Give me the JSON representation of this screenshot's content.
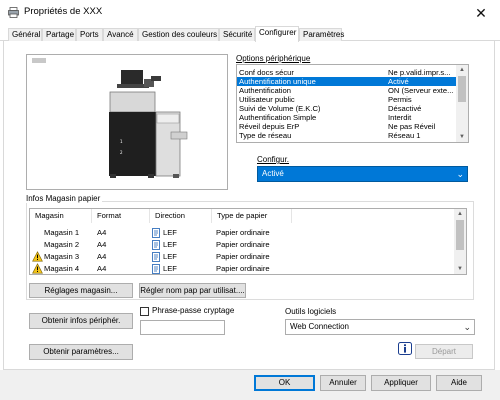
{
  "window": {
    "title": "Propriétés de XXX",
    "close_glyph": "✕",
    "tabs": [
      {
        "label": "Général"
      },
      {
        "label": "Partage"
      },
      {
        "label": "Ports"
      },
      {
        "label": "Avancé"
      },
      {
        "label": "Gestion des couleurs"
      },
      {
        "label": "Sécurité"
      },
      {
        "label": "Configurer"
      },
      {
        "label": "Paramètres"
      }
    ]
  },
  "device_options": {
    "label": "Options périphérique",
    "items": [
      {
        "key": "Conf docs sécur",
        "value": "Ne p.valid.impr.s..."
      },
      {
        "key": "Authentification unique",
        "value": "Activé",
        "selected": true
      },
      {
        "key": "Authentification",
        "value": "ON (Serveur exte..."
      },
      {
        "key": "Utilisateur public",
        "value": "Permis"
      },
      {
        "key": "Suivi de Volume (E.K.C)",
        "value": "Désactivé"
      },
      {
        "key": "Authentification Simple",
        "value": "Interdit"
      },
      {
        "key": "Réveil depuis ErP",
        "value": "Ne pas Réveil"
      },
      {
        "key": "Type de réseau",
        "value": "Réseau 1"
      }
    ]
  },
  "configur": {
    "label": "Configur.",
    "value": "Activé"
  },
  "paper_info": {
    "label": "Infos Magasin papier",
    "columns": [
      "Magasin",
      "Format",
      "Direction",
      "Type de papier"
    ],
    "rows": [
      {
        "tray": "Magasin 1",
        "format": "A4",
        "direction": "LEF",
        "type": "Papier ordinaire",
        "warning": false
      },
      {
        "tray": "Magasin 2",
        "format": "A4",
        "direction": "LEF",
        "type": "Papier ordinaire",
        "warning": false
      },
      {
        "tray": "Magasin 3",
        "format": "A4",
        "direction": "LEF",
        "type": "Papier ordinaire",
        "warning": true
      },
      {
        "tray": "Magasin 4",
        "format": "A4",
        "direction": "LEF",
        "type": "Papier ordinaire",
        "warning": true
      }
    ],
    "tray_settings_button": "Réglages magasin...",
    "user_paper_name_button": "Régler nom pap par utilisat...."
  },
  "actions": {
    "get_device_info_button": "Obtenir infos périphér.",
    "passphrase_label": "Phrase-passe cryptage",
    "passphrase_value": "",
    "get_settings_button": "Obtenir paramètres...",
    "software_tools_label": "Outils logiciels",
    "software_tools_value": "Web Connection",
    "start_button": "Départ"
  },
  "footer": {
    "ok": "OK",
    "cancel": "Annuler",
    "apply": "Appliquer",
    "help": "Aide"
  },
  "colors": {
    "selection": "#0078d7",
    "warning": "#f5c518"
  }
}
